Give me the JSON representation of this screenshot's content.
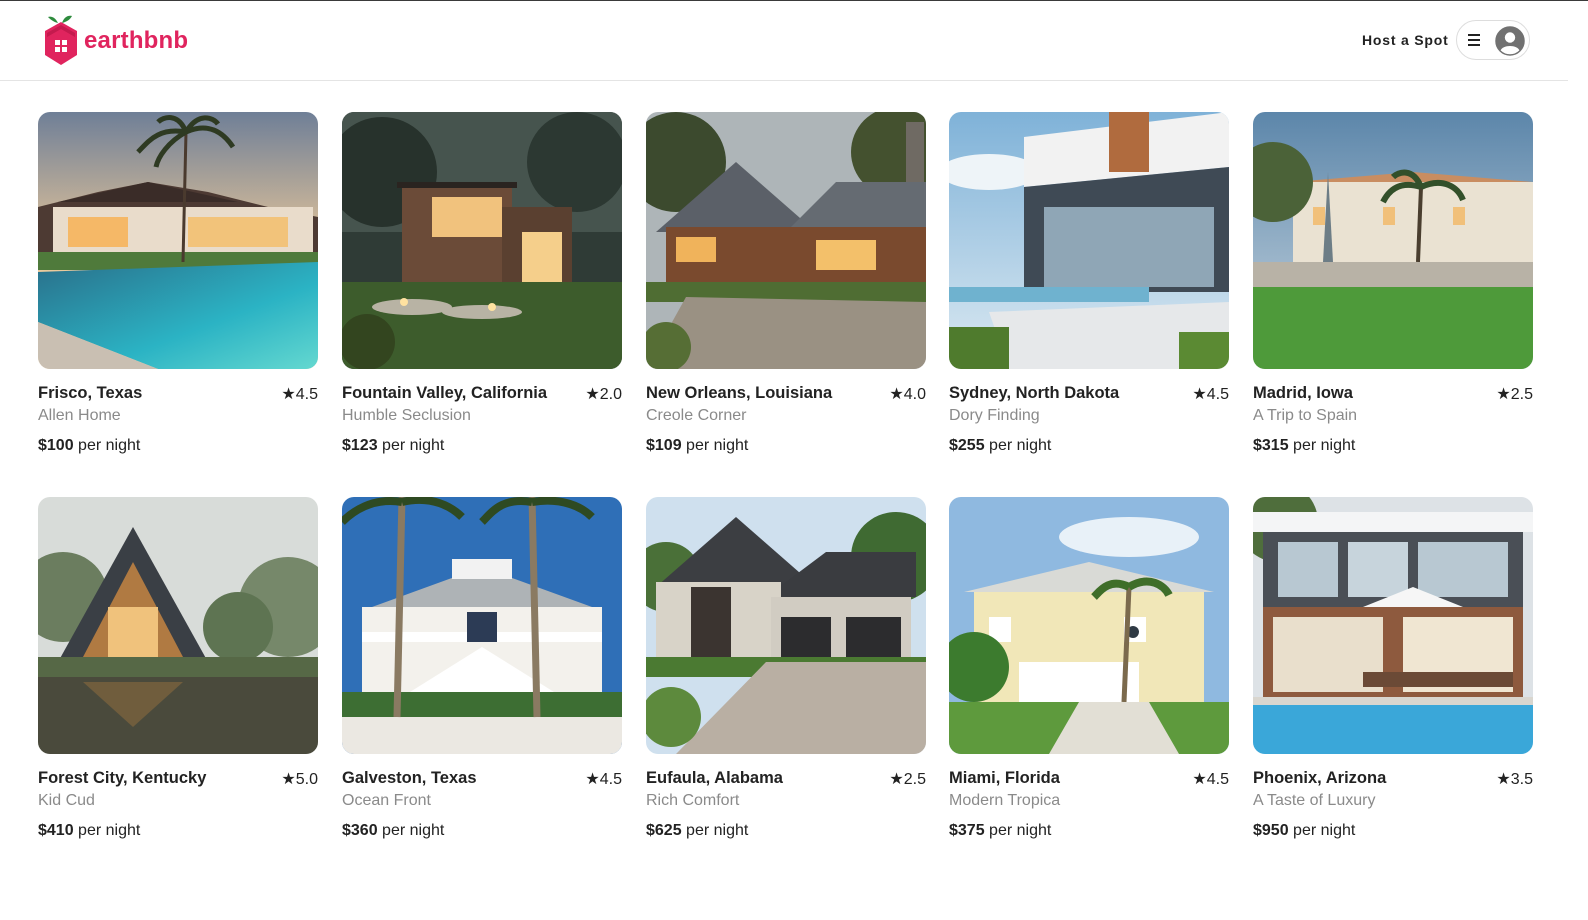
{
  "brand": {
    "name": "earthbnb",
    "accent_color": "#e0245e"
  },
  "header": {
    "host_link": "Host a Spot",
    "menu_icon": "hamburger-menu-icon",
    "avatar_icon": "user-avatar-icon"
  },
  "price_suffix": "per night",
  "rating_icon": "★",
  "listings": [
    {
      "location": "Frisco, Texas",
      "rating": "4.5",
      "name": "Allen Home",
      "price": "$100",
      "photo": "pool-villa-sunset"
    },
    {
      "location": "Fountain Valley, California",
      "rating": "2.0",
      "name": "Humble Seclusion",
      "price": "$123",
      "photo": "modern-wood-house-night"
    },
    {
      "location": "New Orleans, Louisiana",
      "rating": "4.0",
      "name": "Creole Corner",
      "price": "$109",
      "photo": "log-cabin-dusk"
    },
    {
      "location": "Sydney, North Dakota",
      "rating": "4.5",
      "name": "Dory Finding",
      "price": "$255",
      "photo": "glass-villa-pool"
    },
    {
      "location": "Madrid, Iowa",
      "rating": "2.5",
      "name": "A Trip to Spain",
      "price": "$315",
      "photo": "mediterranean-villa-lawn"
    },
    {
      "location": "Forest City, Kentucky",
      "rating": "5.0",
      "name": "Kid Cud",
      "price": "$410",
      "photo": "a-frame-lake"
    },
    {
      "location": "Galveston, Texas",
      "rating": "4.5",
      "name": "Ocean Front",
      "price": "$360",
      "photo": "white-beach-house-palms"
    },
    {
      "location": "Eufaula, Alabama",
      "rating": "2.5",
      "name": "Rich Comfort",
      "price": "$625",
      "photo": "stone-house-driveway"
    },
    {
      "location": "Miami, Florida",
      "rating": "4.5",
      "name": "Modern Tropica",
      "price": "$375",
      "photo": "yellow-tropical-house"
    },
    {
      "location": "Phoenix, Arizona",
      "rating": "3.5",
      "name": "A Taste of Luxury",
      "price": "$950",
      "photo": "luxury-pool-patio"
    }
  ]
}
